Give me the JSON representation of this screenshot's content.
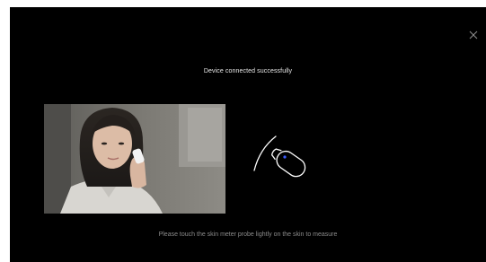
{
  "dialog": {
    "title": "Device connected successfully",
    "instruction": "Please touch the skin meter probe lightly on the skin to measure",
    "close_icon": "close-icon",
    "illustration_photo": "woman-using-skin-meter-photo",
    "illustration_icon": "skin-meter-probe-icon",
    "accent_color": "#3a5cff"
  }
}
